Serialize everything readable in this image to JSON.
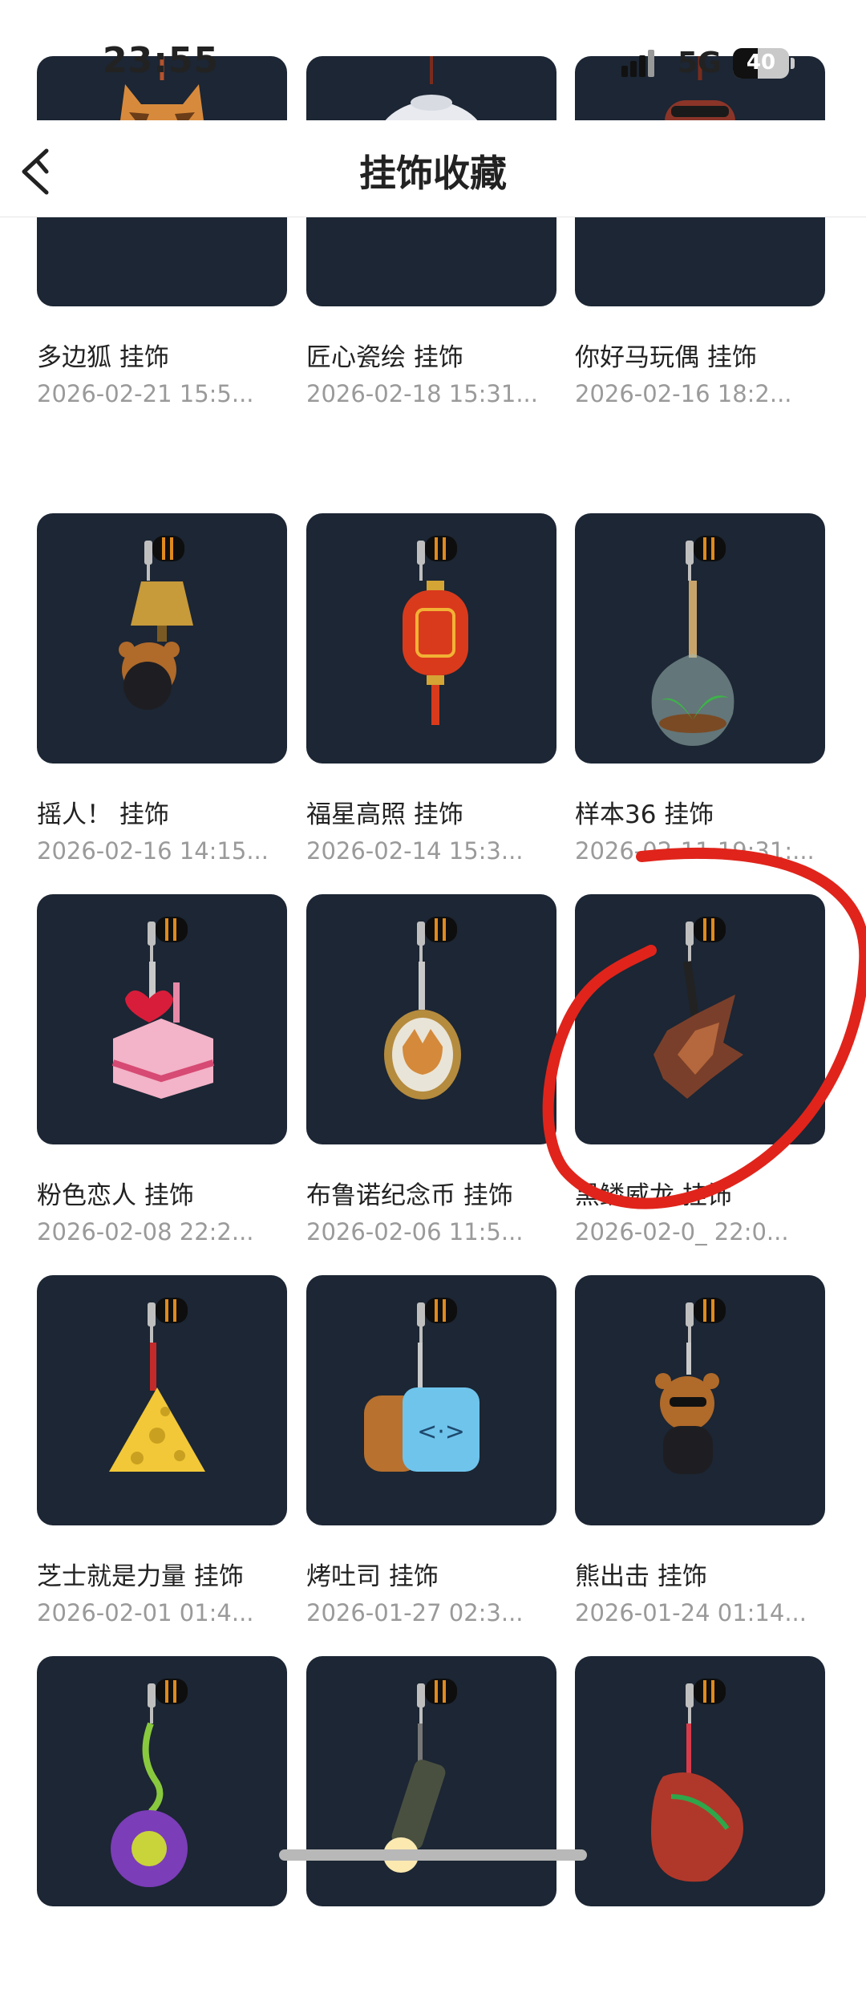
{
  "status_bar": {
    "time": "23:55",
    "network": "5G",
    "battery": "40"
  },
  "header": {
    "title": "挂饰收藏",
    "back_icon": "chevron-left-icon"
  },
  "colors": {
    "thumbnail_bg": "#1c2634",
    "annotation": "#e0241b"
  },
  "items": [
    {
      "name": "多边狐 挂饰",
      "date": "2026-02-21 15:5...",
      "icon": "polygon-fox"
    },
    {
      "name": "匠心瓷绘 挂饰",
      "date": "2026-02-18 15:31...",
      "icon": "teapot"
    },
    {
      "name": "你好马玩偶 挂饰",
      "date": "2026-02-16 18:2...",
      "icon": "horse-doll"
    },
    {
      "name": "摇人！ 挂饰",
      "date": "2026-02-16 14:15...",
      "icon": "bell-bear"
    },
    {
      "name": "福星高照 挂饰",
      "date": "2026-02-14 15:3...",
      "icon": "red-lantern"
    },
    {
      "name": "样本36 挂饰",
      "date": "2026-02-11 19:31:...",
      "icon": "sprout-flask"
    },
    {
      "name": "粉色恋人 挂饰",
      "date": "2026-02-08 22:2...",
      "icon": "pink-cake"
    },
    {
      "name": "布鲁诺纪念币 挂饰",
      "date": "2026-02-06 11:5...",
      "icon": "dog-coin"
    },
    {
      "name": "黑鳞威龙 挂饰",
      "date": "2026-02-0_ 22:0...",
      "icon": "dragon-scale"
    },
    {
      "name": "芝士就是力量 挂饰",
      "date": "2026-02-01 01:4...",
      "icon": "cheese"
    },
    {
      "name": "烤吐司 挂饰",
      "date": "2026-01-27 02:3...",
      "icon": "toast"
    },
    {
      "name": "熊出击 挂饰",
      "date": "2026-01-24 01:14...",
      "icon": "attack-bear"
    },
    {
      "name": "",
      "date": "",
      "icon": "yoyo"
    },
    {
      "name": "",
      "date": "",
      "icon": "flashlight"
    },
    {
      "name": "",
      "date": "",
      "icon": "flip-flop"
    }
  ]
}
